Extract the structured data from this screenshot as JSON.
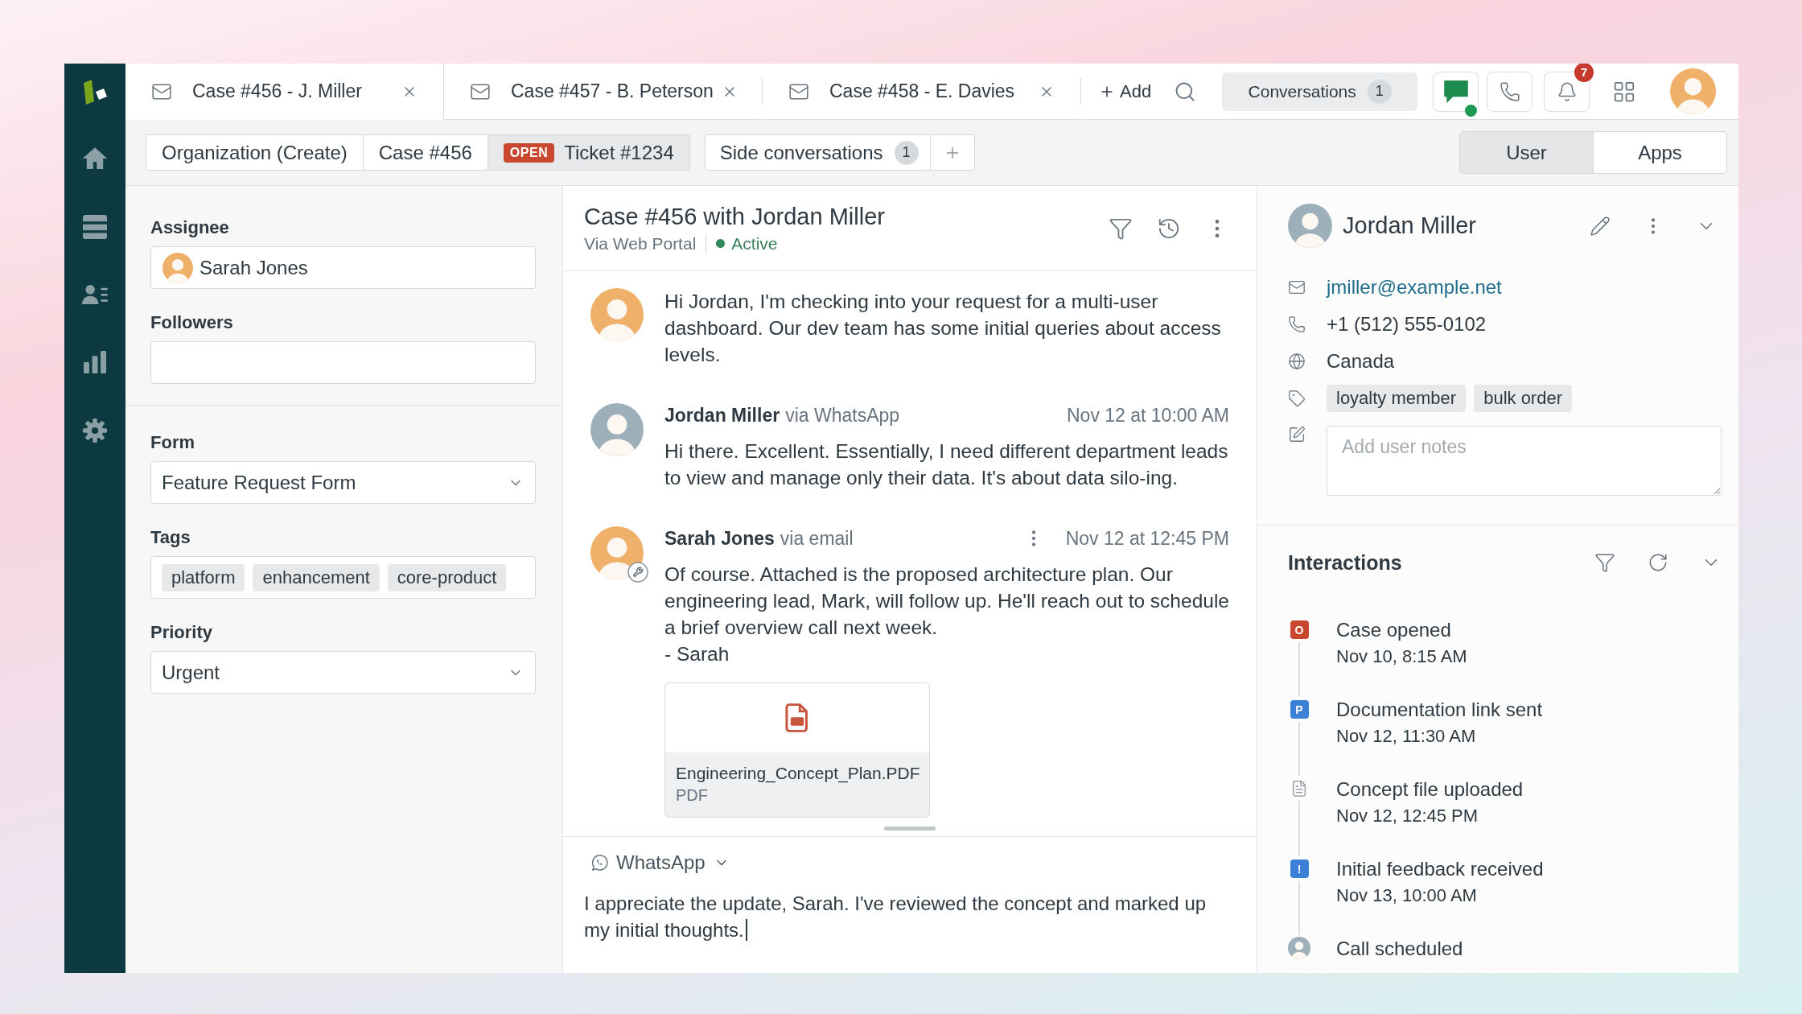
{
  "tabs": [
    {
      "label": "Case #456 - J. Miller",
      "selected": true
    },
    {
      "label": "Case #457 - B. Peterson",
      "selected": false
    },
    {
      "label": "Case #458 - E. Davies",
      "selected": false
    }
  ],
  "toolbar": {
    "add": "Add",
    "conversations": {
      "label": "Conversations",
      "count": "1"
    },
    "chat": {
      "online": true
    },
    "notifications": {
      "count": "7"
    }
  },
  "subbar": {
    "crumbs": [
      {
        "label": "Organization (Create)",
        "selected": false
      },
      {
        "label": "Case #456",
        "selected": false
      },
      {
        "label": "Ticket #1234",
        "badge": "OPEN",
        "selected": true
      }
    ],
    "side_conversations": {
      "label": "Side conversations",
      "count": "1"
    },
    "views": [
      {
        "label": "User",
        "selected": true
      },
      {
        "label": "Apps",
        "selected": false
      }
    ]
  },
  "ticket_fields": [
    {
      "fields": [
        {
          "kind": "person",
          "label": "Assignee",
          "value": "Sarah Jones"
        },
        {
          "kind": "text",
          "label": "Followers"
        }
      ]
    },
    {
      "fields": [
        {
          "kind": "select",
          "label": "Form",
          "value": "Feature Request Form"
        },
        {
          "kind": "tags",
          "label": "Tags",
          "tags": [
            "platform",
            "enhancement",
            "core-product"
          ]
        },
        {
          "kind": "select",
          "label": "Priority",
          "value": "Urgent"
        }
      ]
    }
  ],
  "conversation": {
    "title": "Case #456 with Jordan Miller",
    "channel": "Via Web Portal",
    "status": "Active",
    "messages": [
      {
        "kind": "agent",
        "badge": false,
        "menu": false,
        "text": "Hi Jordan, I'm checking into your request for a multi-user dashboard. Our dev team has some initial queries about access levels."
      },
      {
        "kind": "customer",
        "author": "Jordan Miller",
        "via": "via WhatsApp",
        "time": "Nov 12 at 10:00 AM",
        "badge": false,
        "menu": false,
        "text": "Hi there. Excellent. Essentially, I need different department leads to view and manage only their data. It's about data silo-ing."
      },
      {
        "kind": "agent",
        "author": "Sarah Jones",
        "via": "via email",
        "time": "Nov 12 at 12:45 PM",
        "badge": true,
        "menu": true,
        "text": "Of course. Attached is the proposed architecture plan. Our engineering lead, Mark, will follow up. He'll reach out to schedule a brief overview call next week.\n- Sarah",
        "attachment": {
          "name": "Engineering_Concept_Plan.PDF",
          "type": "PDF"
        }
      }
    ],
    "composer": {
      "channel": "WhatsApp",
      "value": "I appreciate the update, Sarah. I've reviewed the concept and marked up my initial thoughts."
    }
  },
  "user": {
    "name": "Jordan Miller",
    "email": "jmiller@example.net",
    "phone": "+1 (512) 555-0102",
    "country": "Canada",
    "tags": [
      "loyalty member",
      "bulk order"
    ],
    "notes": {
      "placeholder": "Add user notes"
    }
  },
  "interactions": {
    "title": "Interactions",
    "items": [
      {
        "kind": "letter",
        "marker": "O",
        "color": "#c8472e",
        "title": "Case opened",
        "time": "Nov 10, 8:15 AM"
      },
      {
        "kind": "letter",
        "marker": "P",
        "color": "#3b7fd6",
        "title": "Documentation link sent",
        "time": "Nov 12, 11:30 AM"
      },
      {
        "kind": "file",
        "title": "Concept file uploaded",
        "time": "Nov 12, 12:45 PM"
      },
      {
        "kind": "letter",
        "marker": "!",
        "color": "#3b7fd6",
        "title": "Initial feedback received",
        "time": "Nov 13, 10:00 AM"
      },
      {
        "kind": "avatar",
        "title": "Call scheduled"
      }
    ]
  }
}
